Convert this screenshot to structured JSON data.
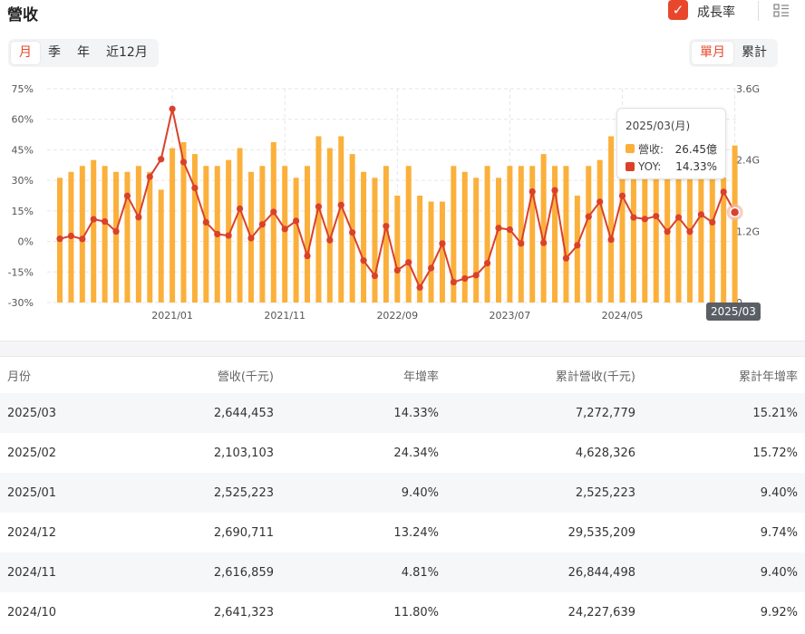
{
  "header": {
    "title": "營收",
    "yoy_label": "成長率",
    "checked": true
  },
  "period_tabs": [
    {
      "label": "月",
      "active": true
    },
    {
      "label": "季",
      "active": false
    },
    {
      "label": "年",
      "active": false
    },
    {
      "label": "近12月",
      "active": false
    }
  ],
  "mode_tabs": [
    {
      "label": "單月",
      "active": true
    },
    {
      "label": "累計",
      "active": false
    }
  ],
  "colors": {
    "accent": "#e8472c",
    "bar": "#fbb03b",
    "line": "#d9412b"
  },
  "chart_data": {
    "type": "bar+line",
    "x_tick_labels": [
      "2021/01",
      "2021/11",
      "2022/09",
      "2023/07",
      "2024/05"
    ],
    "left_axis_ticks": [
      "75%",
      "60%",
      "45%",
      "30%",
      "15%",
      "0%",
      "-15%",
      "-30%"
    ],
    "right_axis_ticks": [
      "3.6G",
      "2.4G",
      "1.2G",
      "0"
    ],
    "left_ylim": [
      -30,
      75
    ],
    "right_ylim": [
      0,
      3.6
    ],
    "months": [
      "2020/03",
      "2020/04",
      "2020/05",
      "2020/06",
      "2020/07",
      "2020/08",
      "2020/09",
      "2020/10",
      "2020/11",
      "2020/12",
      "2021/01",
      "2021/02",
      "2021/03",
      "2021/04",
      "2021/05",
      "2021/06",
      "2021/07",
      "2021/08",
      "2021/09",
      "2021/10",
      "2021/11",
      "2021/12",
      "2022/01",
      "2022/02",
      "2022/03",
      "2022/04",
      "2022/05",
      "2022/06",
      "2022/07",
      "2022/08",
      "2022/09",
      "2022/10",
      "2022/11",
      "2022/12",
      "2023/01",
      "2023/02",
      "2023/03",
      "2023/04",
      "2023/05",
      "2023/06",
      "2023/07",
      "2023/08",
      "2023/09",
      "2023/10",
      "2023/11",
      "2023/12",
      "2024/01",
      "2024/02",
      "2024/03",
      "2024/04",
      "2024/05",
      "2024/06",
      "2024/07",
      "2024/08",
      "2024/09",
      "2024/10",
      "2024/11",
      "2024/12",
      "2025/01",
      "2025/02",
      "2025/03"
    ],
    "series": [
      {
        "name": "營收",
        "unit": "G",
        "values": [
          2.1,
          2.2,
          2.3,
          2.4,
          2.3,
          2.2,
          2.2,
          2.3,
          2.2,
          1.9,
          2.6,
          2.7,
          2.5,
          2.3,
          2.3,
          2.4,
          2.6,
          2.2,
          2.3,
          2.7,
          2.3,
          2.1,
          2.3,
          2.8,
          2.6,
          2.8,
          2.5,
          2.2,
          2.1,
          2.3,
          1.8,
          2.3,
          1.8,
          1.7,
          1.7,
          2.3,
          2.2,
          2.1,
          2.3,
          2.1,
          2.3,
          2.3,
          2.3,
          2.5,
          2.3,
          2.3,
          1.8,
          2.3,
          2.4,
          2.8,
          2.8,
          2.4,
          2.5,
          2.6,
          2.7,
          2.641,
          2.617,
          2.691,
          2.525,
          2.103,
          2.6445
        ]
      },
      {
        "name": "YOY",
        "unit": "%",
        "values": [
          1.3,
          2.7,
          1.2,
          10.9,
          9.8,
          4.9,
          22.4,
          11.9,
          31.8,
          40.4,
          65.1,
          39.0,
          26.3,
          9.4,
          3.6,
          2.9,
          16.1,
          1.6,
          8.4,
          14.5,
          6.1,
          10.1,
          -7.1,
          17.1,
          0.6,
          17.9,
          4.4,
          -9.4,
          -16.9,
          7.5,
          -14.2,
          -10.3,
          -22.6,
          -13.1,
          -1.0,
          -20.0,
          -18.2,
          -16.6,
          -10.7,
          6.6,
          5.8,
          -1.0,
          24.5,
          -0.7,
          25.1,
          -8.3,
          -1.9,
          12.2,
          19.5,
          0.9,
          22.4,
          11.8,
          11.0,
          12.4,
          4.8,
          11.8,
          4.81,
          13.24,
          9.4,
          24.34,
          14.33
        ]
      }
    ],
    "tooltip": {
      "date": "2025/03(月)",
      "revenue_label": "營收:",
      "revenue_value": "26.45億",
      "yoy_label": "YOY:",
      "yoy_value": "14.33%"
    },
    "highlight_label": "2025/03"
  },
  "table": {
    "headers": [
      "月份",
      "營收(千元)",
      "年增率",
      "累計營收(千元)",
      "累計年增率"
    ],
    "rows": [
      [
        "2025/03",
        "2,644,453",
        "14.33%",
        "7,272,779",
        "15.21%"
      ],
      [
        "2025/02",
        "2,103,103",
        "24.34%",
        "4,628,326",
        "15.72%"
      ],
      [
        "2025/01",
        "2,525,223",
        "9.40%",
        "2,525,223",
        "9.40%"
      ],
      [
        "2024/12",
        "2,690,711",
        "13.24%",
        "29,535,209",
        "9.74%"
      ],
      [
        "2024/11",
        "2,616,859",
        "4.81%",
        "26,844,498",
        "9.40%"
      ],
      [
        "2024/10",
        "2,641,323",
        "11.80%",
        "24,227,639",
        "9.92%"
      ]
    ]
  }
}
